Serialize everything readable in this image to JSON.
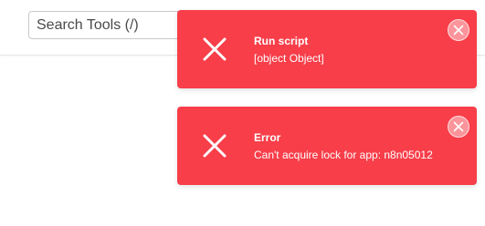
{
  "header": {
    "search": {
      "placeholder": "Search Tools (/)",
      "value": ""
    }
  },
  "toasts": [
    {
      "title": "Run script",
      "message": "[object Object]",
      "icon": "x-icon",
      "close_icon": "close-icon",
      "color": "#f73e49"
    },
    {
      "title": "Error",
      "message": "Can't acquire lock for app: n8n05012",
      "icon": "x-icon",
      "close_icon": "close-icon",
      "color": "#f73e49"
    }
  ]
}
